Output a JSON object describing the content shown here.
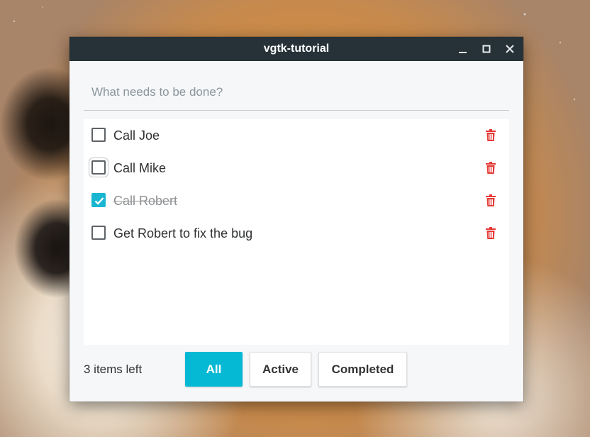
{
  "window": {
    "title": "vgtk-tutorial"
  },
  "new_todo": {
    "placeholder": "What needs to be done?",
    "value": ""
  },
  "todos": [
    {
      "label": "Call Joe",
      "completed": false
    },
    {
      "label": "Call Mike",
      "completed": false
    },
    {
      "label": "Call Robert",
      "completed": true
    },
    {
      "label": "Get Robert to fix the bug",
      "completed": false
    }
  ],
  "footer": {
    "items_left": "3 items left",
    "filters": {
      "all": "All",
      "active": "Active",
      "completed": "Completed"
    },
    "selected_filter": "All"
  },
  "icons": {
    "delete": "trash-icon",
    "minimize": "minimize-icon",
    "maximize": "maximize-icon",
    "close": "close-icon",
    "check": "checkmark-icon"
  },
  "colors": {
    "titlebar": "#263238",
    "accent": "#05b9d4",
    "delete": "#e53935"
  }
}
